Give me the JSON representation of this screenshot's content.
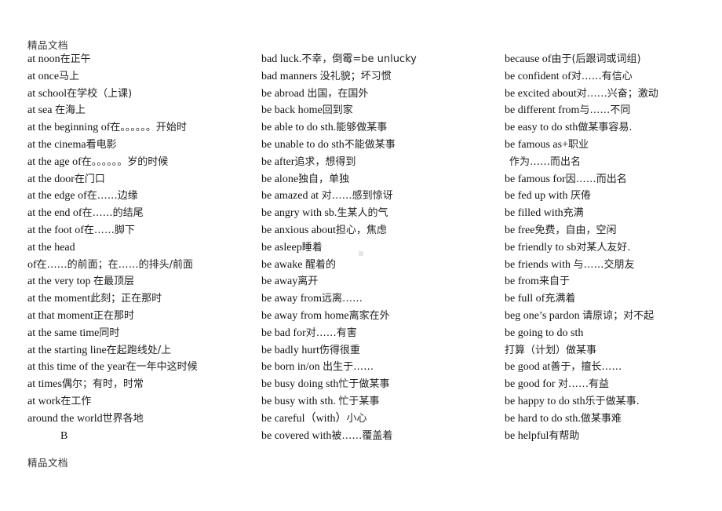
{
  "document": {
    "header_mark": "精品文档",
    "footer_mark": "精品文档"
  },
  "columns": {
    "left": [
      {
        "en": "at noon",
        "zh": "在正午"
      },
      {
        "en": "at once",
        "zh": "马上"
      },
      {
        "en": "at school",
        "zh": "在学校（上课)"
      },
      {
        "en": "at sea ",
        "zh": "在海上"
      },
      {
        "en": "at the beginning of",
        "zh": "在。。。。。。开始时"
      },
      {
        "en": "at the cinema",
        "zh": "看电影"
      },
      {
        "en": "at the age of",
        "zh": "在。。。。。。岁的时候"
      },
      {
        "en": "at the door",
        "zh": "在门口"
      },
      {
        "en": "at the edge of",
        "zh": "在……边缘"
      },
      {
        "en": "at the end of",
        "zh": "在……的结尾"
      },
      {
        "en": "at the foot of",
        "zh": "在……脚下"
      },
      {
        "en": "at the head",
        "zh": ""
      },
      {
        "en": "of",
        "zh": "在……的前面；在……的排头/前面"
      },
      {
        "en": "at the very top ",
        "zh": "在最顶层"
      },
      {
        "en": "at the moment",
        "zh": "此刻；正在那时"
      },
      {
        "en": "at that moment",
        "zh": "正在那时"
      },
      {
        "en": "at the same time",
        "zh": "同时"
      },
      {
        "en": "at the starting line",
        "zh": "在起跑线处/上"
      },
      {
        "en": "at this time of the year",
        "zh": "在一年中这时候"
      },
      {
        "en": "at times",
        "zh": "偶尔；有时，时常"
      },
      {
        "en": "at work",
        "zh": "在工作"
      },
      {
        "en": "around the world",
        "zh": "世界各地"
      },
      {
        "en": "B",
        "zh": "",
        "indent": true
      }
    ],
    "middle": [
      {
        "en": "bad luck.",
        "zh": "不幸，倒霉=be unlucky"
      },
      {
        "en": "bad manners  ",
        "zh": "没礼貌；坏习惯"
      },
      {
        "en": "be abroad ",
        "zh": "出国，在国外"
      },
      {
        "en": "be back home",
        "zh": "回到家"
      },
      {
        "en": "be able to do sth.",
        "zh": "能够做某事"
      },
      {
        "en": "be unable to do sth",
        "zh": "不能做某事"
      },
      {
        "en": "be after",
        "zh": "追求，想得到"
      },
      {
        "en": "be alone",
        "zh": "独自，单独"
      },
      {
        "en": "be amazed at ",
        "zh": "对……感到惊讶"
      },
      {
        "en": "be angry with sb.",
        "zh": "生某人的气"
      },
      {
        "en": "be anxious about",
        "zh": "担心，焦虑"
      },
      {
        "en": "be asleep",
        "zh": "睡着"
      },
      {
        "en": "be awake ",
        "zh": "醒着的"
      },
      {
        "en": "be away",
        "zh": "离开"
      },
      {
        "en": "be away from",
        "zh": "远离……"
      },
      {
        "en": "be away from home",
        "zh": "离家在外"
      },
      {
        "en": "be bad for",
        "zh": "对……有害"
      },
      {
        "en": "be badly hurt",
        "zh": "伤得很重"
      },
      {
        "en": "be born in/on ",
        "zh": "出生于……"
      },
      {
        "en": "be busy doing sth",
        "zh": "忙于做某事"
      },
      {
        "en": "be busy with sth. ",
        "zh": "忙于某事"
      },
      {
        "en": "be careful（with）",
        "zh": "小心"
      },
      {
        "en": "be covered with",
        "zh": "被……覆盖着"
      }
    ],
    "right": [
      {
        "en": "because of",
        "zh": "由于(后跟词或词组)"
      },
      {
        "en": "be confident of",
        "zh": "对……有信心"
      },
      {
        "en": "be excited  about",
        "zh": "对……兴奋；激动"
      },
      {
        "en": "be different from",
        "zh": "与……不同"
      },
      {
        "en": "be easy to do sth",
        "zh": "做某事容易."
      },
      {
        "en": "be famous as+",
        "zh": "职业"
      },
      {
        "en": "",
        "zh": "作为……而出名",
        "indent_small": true
      },
      {
        "en": "be famous for",
        "zh": "因……而出名"
      },
      {
        "en": "be fed up with  ",
        "zh": "厌倦"
      },
      {
        "en": "be filled with",
        "zh": "充满"
      },
      {
        "en": "be free",
        "zh": "免费，自由，空闲"
      },
      {
        "en": "be friendly to sb",
        "zh": "对某人友好."
      },
      {
        "en": "be friends with ",
        "zh": "与……交朋友"
      },
      {
        "en": "be from",
        "zh": "来自于"
      },
      {
        "en": "be full of",
        "zh": "充满着"
      },
      {
        "en": "beg one’s pardon ",
        "zh": "请原谅；对不起"
      },
      {
        "en": "be going to do sth",
        "zh": ""
      },
      {
        "en": "",
        "zh": "打算（计划）做某事"
      },
      {
        "en": "be good at",
        "zh": "善于，擅长……"
      },
      {
        "en": "be good for ",
        "zh": "对……有益"
      },
      {
        "en": "be happy to do sth",
        "zh": "乐于做某事."
      },
      {
        "en": "be hard to do sth.",
        "zh": "做某事难"
      },
      {
        "en": "be helpful",
        "zh": "有帮助"
      }
    ]
  }
}
